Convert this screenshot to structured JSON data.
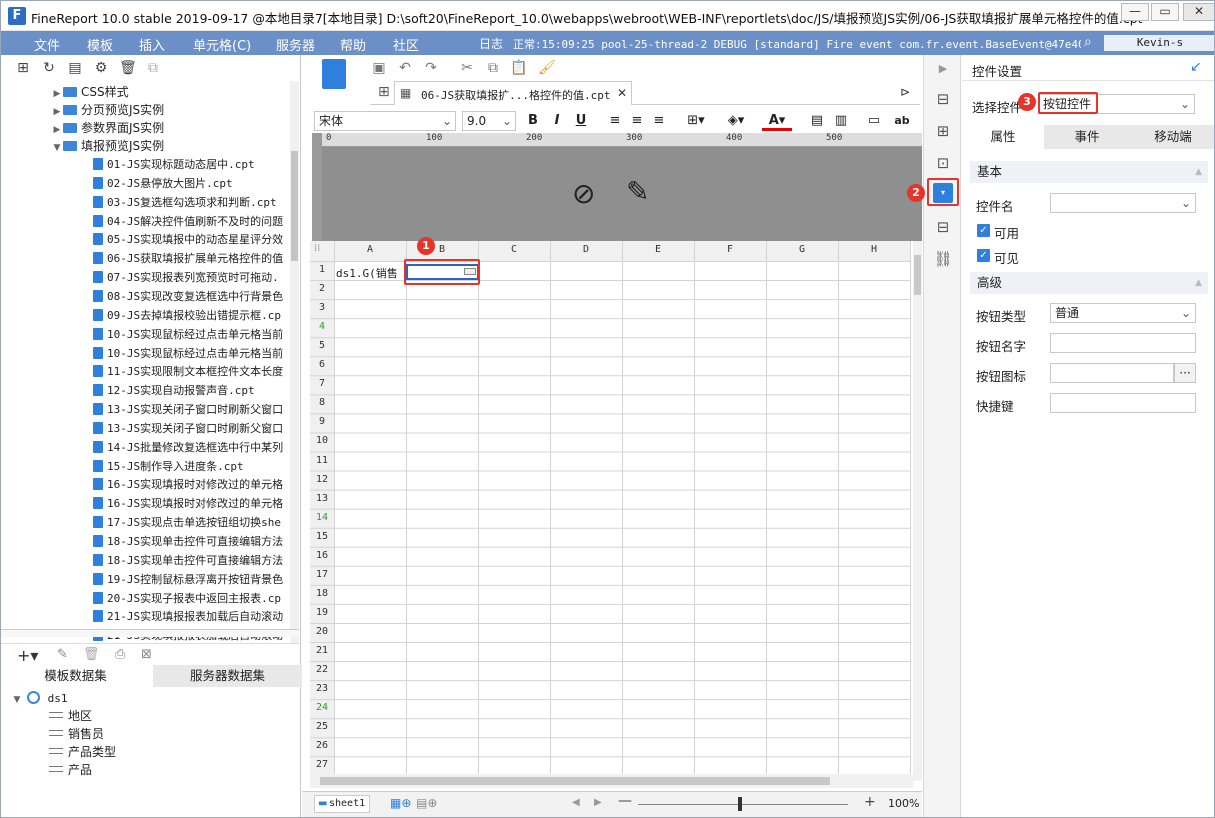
{
  "window": {
    "title": "FineReport 10.0 stable 2019-09-17 @本地目录7[本地目录]    D:\\soft20\\FineReport_10.0\\webapps\\webroot\\WEB-INF\\reportlets\\doc/JS/填报预览JS实例/06-JS获取填报扩展单元格控件的值.cpt",
    "minimize": "—",
    "restore": "▭",
    "close": "✕"
  },
  "menu": {
    "items": [
      "文件",
      "模板",
      "插入",
      "单元格(C)",
      "服务器",
      "帮助",
      "社区"
    ],
    "log_label": "日志",
    "log_text": "正常:15:09:25 pool-25-thread-2 DEBUG [standard] Fire event com.fr.event.BaseEvent@47e40dbf...",
    "user": "Kevin-s"
  },
  "tree": {
    "folders": [
      "CSS样式",
      "分页预览JS实例",
      "参数界面JS实例",
      "填报预览JS实例"
    ],
    "files": [
      "01-JS实现标题动态居中.cpt",
      "02-JS悬停放大图片.cpt",
      "03-JS复选框勾选项求和判断.cpt",
      "04-JS解决控件值刷新不及时的问题",
      "05-JS实现填报中的动态星星评分效",
      "06-JS获取填报扩展单元格控件的值",
      "07-JS实现报表列宽预览时可拖动.",
      "08-JS实现改变复选框选中行背景色",
      "09-JS去掉填报校验出错提示框.cp",
      "10-JS实现鼠标经过点击单元格当前",
      "10-JS实现鼠标经过点击单元格当前",
      "11-JS实现限制文本框控件文本长度",
      "12-JS实现自动报警声音.cpt",
      "13-JS实现关闭子窗口时刷新父窗口",
      "13-JS实现关闭子窗口时刷新父窗口",
      "14-JS批量修改复选框选中行中某列",
      "15-JS制作导入进度条.cpt",
      "16-JS实现填报时对修改过的单元格",
      "16-JS实现填报时对修改过的单元格",
      "17-JS实现点击单选按钮组切换she",
      "18-JS实现单击控件可直接编辑方法",
      "18-JS实现单击控件可直接编辑方法",
      "19-JS控制鼠标悬浮离开按钮背景色",
      "20-JS实现子报表中返回主报表.cp",
      "21-JS实现填报报表加载后自动滚动",
      "21-JS实现填报报表加载后自动滚动"
    ]
  },
  "datasets": {
    "tabs": [
      "模板数据集",
      "服务器数据集"
    ],
    "root": "ds1",
    "fields": [
      "地区",
      "销售员",
      "产品类型",
      "产品"
    ]
  },
  "editor": {
    "file_tab": "06-JS获取填报扩...格控件的值.cpt",
    "font_name": "宋体",
    "font_size": "9.0",
    "ruler_ticks": [
      "0",
      "100",
      "200",
      "300",
      "400",
      "500"
    ],
    "columns": [
      "A",
      "B",
      "C",
      "D",
      "E",
      "F",
      "G",
      "H"
    ],
    "rows": [
      "1",
      "2",
      "3",
      "4",
      "5",
      "6",
      "7",
      "8",
      "9",
      "10",
      "11",
      "12",
      "13",
      "14",
      "15",
      "16",
      "17",
      "18",
      "19",
      "20",
      "21",
      "22",
      "23",
      "24",
      "25",
      "26",
      "27"
    ],
    "cell_a1": "ds1.G(销售",
    "sheet_name": "sheet1",
    "zoom": "100%"
  },
  "right_panel": {
    "title": "控件设置",
    "select_label": "选择控件",
    "select_value": "按钮控件",
    "tabs": [
      "属性",
      "事件",
      "移动端"
    ],
    "section_basic": "基本",
    "widget_name_label": "控件名",
    "enabled_label": "可用",
    "visible_label": "可见",
    "section_advanced": "高级",
    "button_type_label": "按钮类型",
    "button_type_value": "普通",
    "button_name_label": "按钮名字",
    "button_icon_label": "按钮图标",
    "hotkey_label": "快捷键"
  },
  "callouts": [
    "1",
    "2",
    "3"
  ],
  "colors": {
    "menubar": "#6b8fc7",
    "accent": "#2f7fdc",
    "callout_red": "#e5352a"
  }
}
